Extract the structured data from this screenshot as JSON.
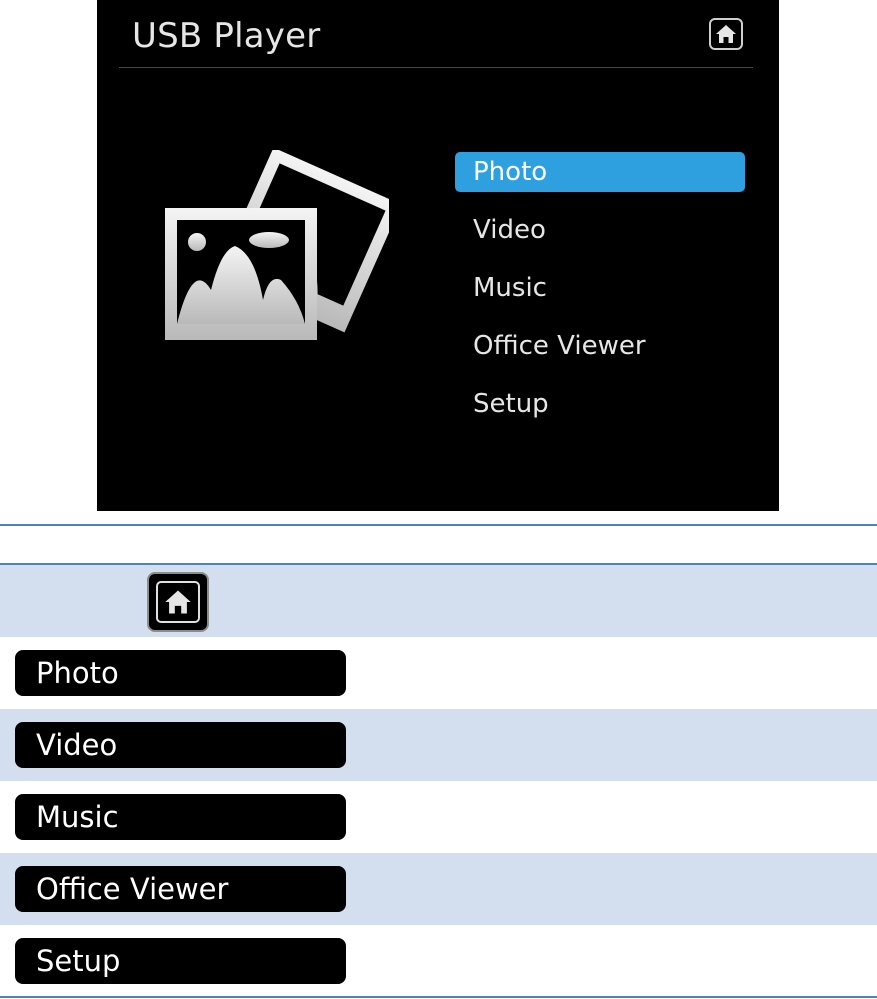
{
  "screen": {
    "title": "USB Player",
    "home_icon": "home-icon",
    "menu": [
      {
        "label": "Photo",
        "selected": true
      },
      {
        "label": "Video",
        "selected": false
      },
      {
        "label": "Music",
        "selected": false
      },
      {
        "label": "Office Viewer",
        "selected": false
      },
      {
        "label": "Setup",
        "selected": false
      }
    ],
    "accent_color": "#2ea0e0",
    "illustration": "photo-gallery-icon"
  },
  "table": {
    "header_icon": "home-icon",
    "header_bg": "#d3dfee",
    "rule_color": "#4f81bd",
    "rows": [
      {
        "label": "Photo"
      },
      {
        "label": "Video"
      },
      {
        "label": "Music"
      },
      {
        "label": "Office Viewer"
      },
      {
        "label": "Setup"
      }
    ]
  }
}
